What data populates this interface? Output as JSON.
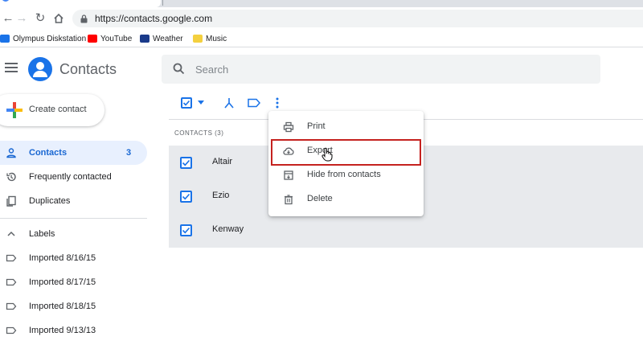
{
  "browser": {
    "url": "https://contacts.google.com",
    "bookmarks": [
      {
        "label": "Olympus Diskstation",
        "color": "#1a73e8"
      },
      {
        "label": "YouTube",
        "color": "#ff0000"
      },
      {
        "label": "Weather",
        "color": "#1a3a8a"
      },
      {
        "label": "Music",
        "color": "#f4d03f"
      }
    ]
  },
  "header": {
    "app_title": "Contacts",
    "search_placeholder": "Search"
  },
  "sidebar": {
    "create_label": "Create contact",
    "items": [
      {
        "label": "Contacts",
        "count": "3",
        "icon": "person-icon",
        "active": true
      },
      {
        "label": "Frequently contacted",
        "icon": "history-icon"
      },
      {
        "label": "Duplicates",
        "icon": "copy-icon"
      }
    ],
    "labels_heading": "Labels",
    "labels": [
      "Imported 8/16/15",
      "Imported 8/17/15",
      "Imported 8/18/15",
      "Imported 9/13/13"
    ]
  },
  "list": {
    "header": "CONTACTS (3)",
    "contacts": [
      "Altair",
      "Ezio",
      "Kenway"
    ]
  },
  "menu": {
    "items": [
      {
        "label": "Print",
        "icon": "print-icon"
      },
      {
        "label": "Export",
        "icon": "cloud-download-icon"
      },
      {
        "label": "Hide from contacts",
        "icon": "archive-icon"
      },
      {
        "label": "Delete",
        "icon": "trash-icon"
      }
    ]
  },
  "colors": {
    "accent": "#1a73e8",
    "highlight_box": "#c5221f",
    "selected_row_bg": "#e8eaed"
  }
}
